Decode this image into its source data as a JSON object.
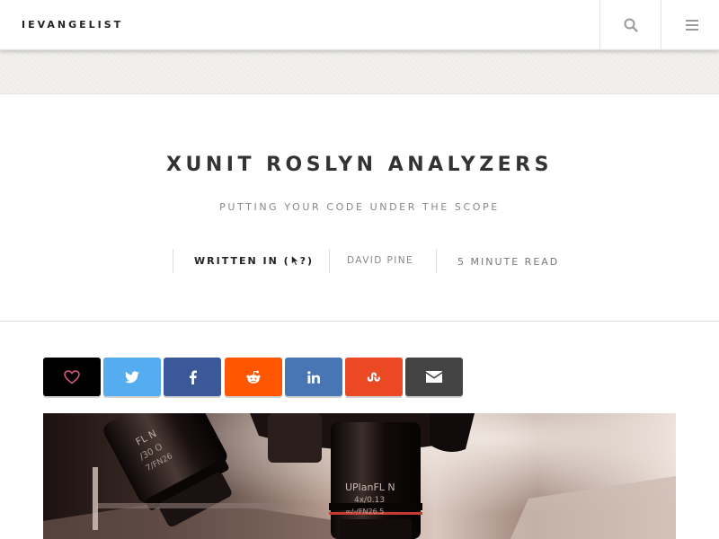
{
  "header": {
    "brand": "IEVANGELIST",
    "search_icon": "search-icon",
    "menu_icon": "hamburger-menu-icon"
  },
  "post": {
    "title": "XUNIT ROSLYN ANALYZERS",
    "subtitle": "PUTTING YOUR CODE UNDER THE SCOPE",
    "meta": {
      "written_in_label": "WRITTEN IN (",
      "written_in_suffix": "?)",
      "author": "DAVID PINE",
      "read_time": "5 MINUTE READ"
    }
  },
  "share": {
    "buttons": [
      {
        "name": "like",
        "icon": "heart-icon",
        "color": "#000000"
      },
      {
        "name": "twitter",
        "icon": "twitter-icon",
        "color": "#55acee"
      },
      {
        "name": "facebook",
        "icon": "facebook-icon",
        "color": "#3b5998"
      },
      {
        "name": "reddit",
        "icon": "reddit-icon",
        "color": "#ff5700"
      },
      {
        "name": "linkedin",
        "icon": "linkedin-icon",
        "color": "#4875b4"
      },
      {
        "name": "stumbleupon",
        "icon": "stumbleupon-icon",
        "color": "#eb4924"
      },
      {
        "name": "email",
        "icon": "email-icon",
        "color": "#444444"
      }
    ]
  },
  "hero": {
    "lens_labels": [
      "UPlanFL N",
      "4x/0.13",
      "∞/-/FN26.5",
      "FL N",
      "/30 O",
      "7/FN26"
    ]
  }
}
